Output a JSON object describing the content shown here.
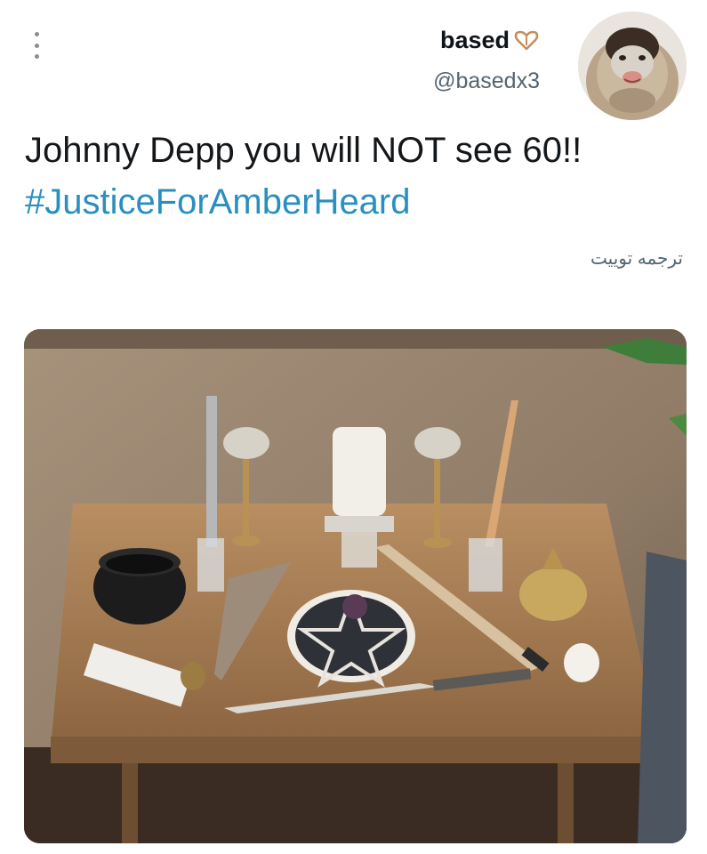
{
  "tweet": {
    "author": {
      "display_name": "based",
      "handle": "@basedx3",
      "name_emoji": "heart-icon",
      "avatar": "monkey-avatar"
    },
    "text_part1": "Johnny Depp you will NOT see 60!! ",
    "hashtag": "#JusticeForAmberHeard",
    "translate_label": "ترجمه توییت",
    "media": {
      "type": "photo",
      "description_icon": "altar-photo"
    },
    "more_options_icon": "more-vertical-icon"
  },
  "colors": {
    "hashtag": "#2a8fc0",
    "handle": "#536471",
    "text": "#14171a"
  }
}
